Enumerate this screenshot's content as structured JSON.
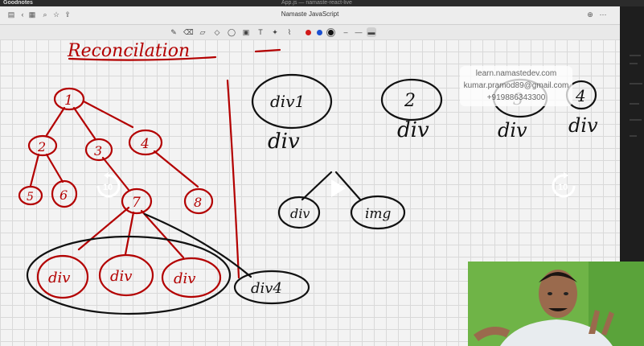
{
  "menubar": {
    "app": "Goodnotes",
    "window_title": "App.js — namaste-react-live"
  },
  "titlebar": {
    "title": "Namaste JavaScript"
  },
  "watermark": {
    "line1": "learn.namastedev.com",
    "line2": "kumar.pramod89@gmail.com",
    "line3": "+919886343300"
  },
  "whiteboard": {
    "heading": "Reconcilation",
    "tree_nodes": [
      "1",
      "2",
      "3",
      "4",
      "5",
      "6",
      "7",
      "8"
    ],
    "leaf_divs": [
      "div",
      "div",
      "div"
    ],
    "right_node": "div4",
    "top_row": {
      "node_labels": [
        "div1",
        "2",
        "3",
        "4"
      ],
      "sub_labels": [
        "div",
        "div",
        "div",
        "div"
      ]
    },
    "small_tree": {
      "left": "div",
      "right": "img"
    }
  },
  "video_controls": {
    "rewind_label": "10",
    "forward_label": "10"
  },
  "colors": {
    "red_ink": "#b30000",
    "black_ink": "#111111",
    "video_bg": "#6fb447"
  }
}
